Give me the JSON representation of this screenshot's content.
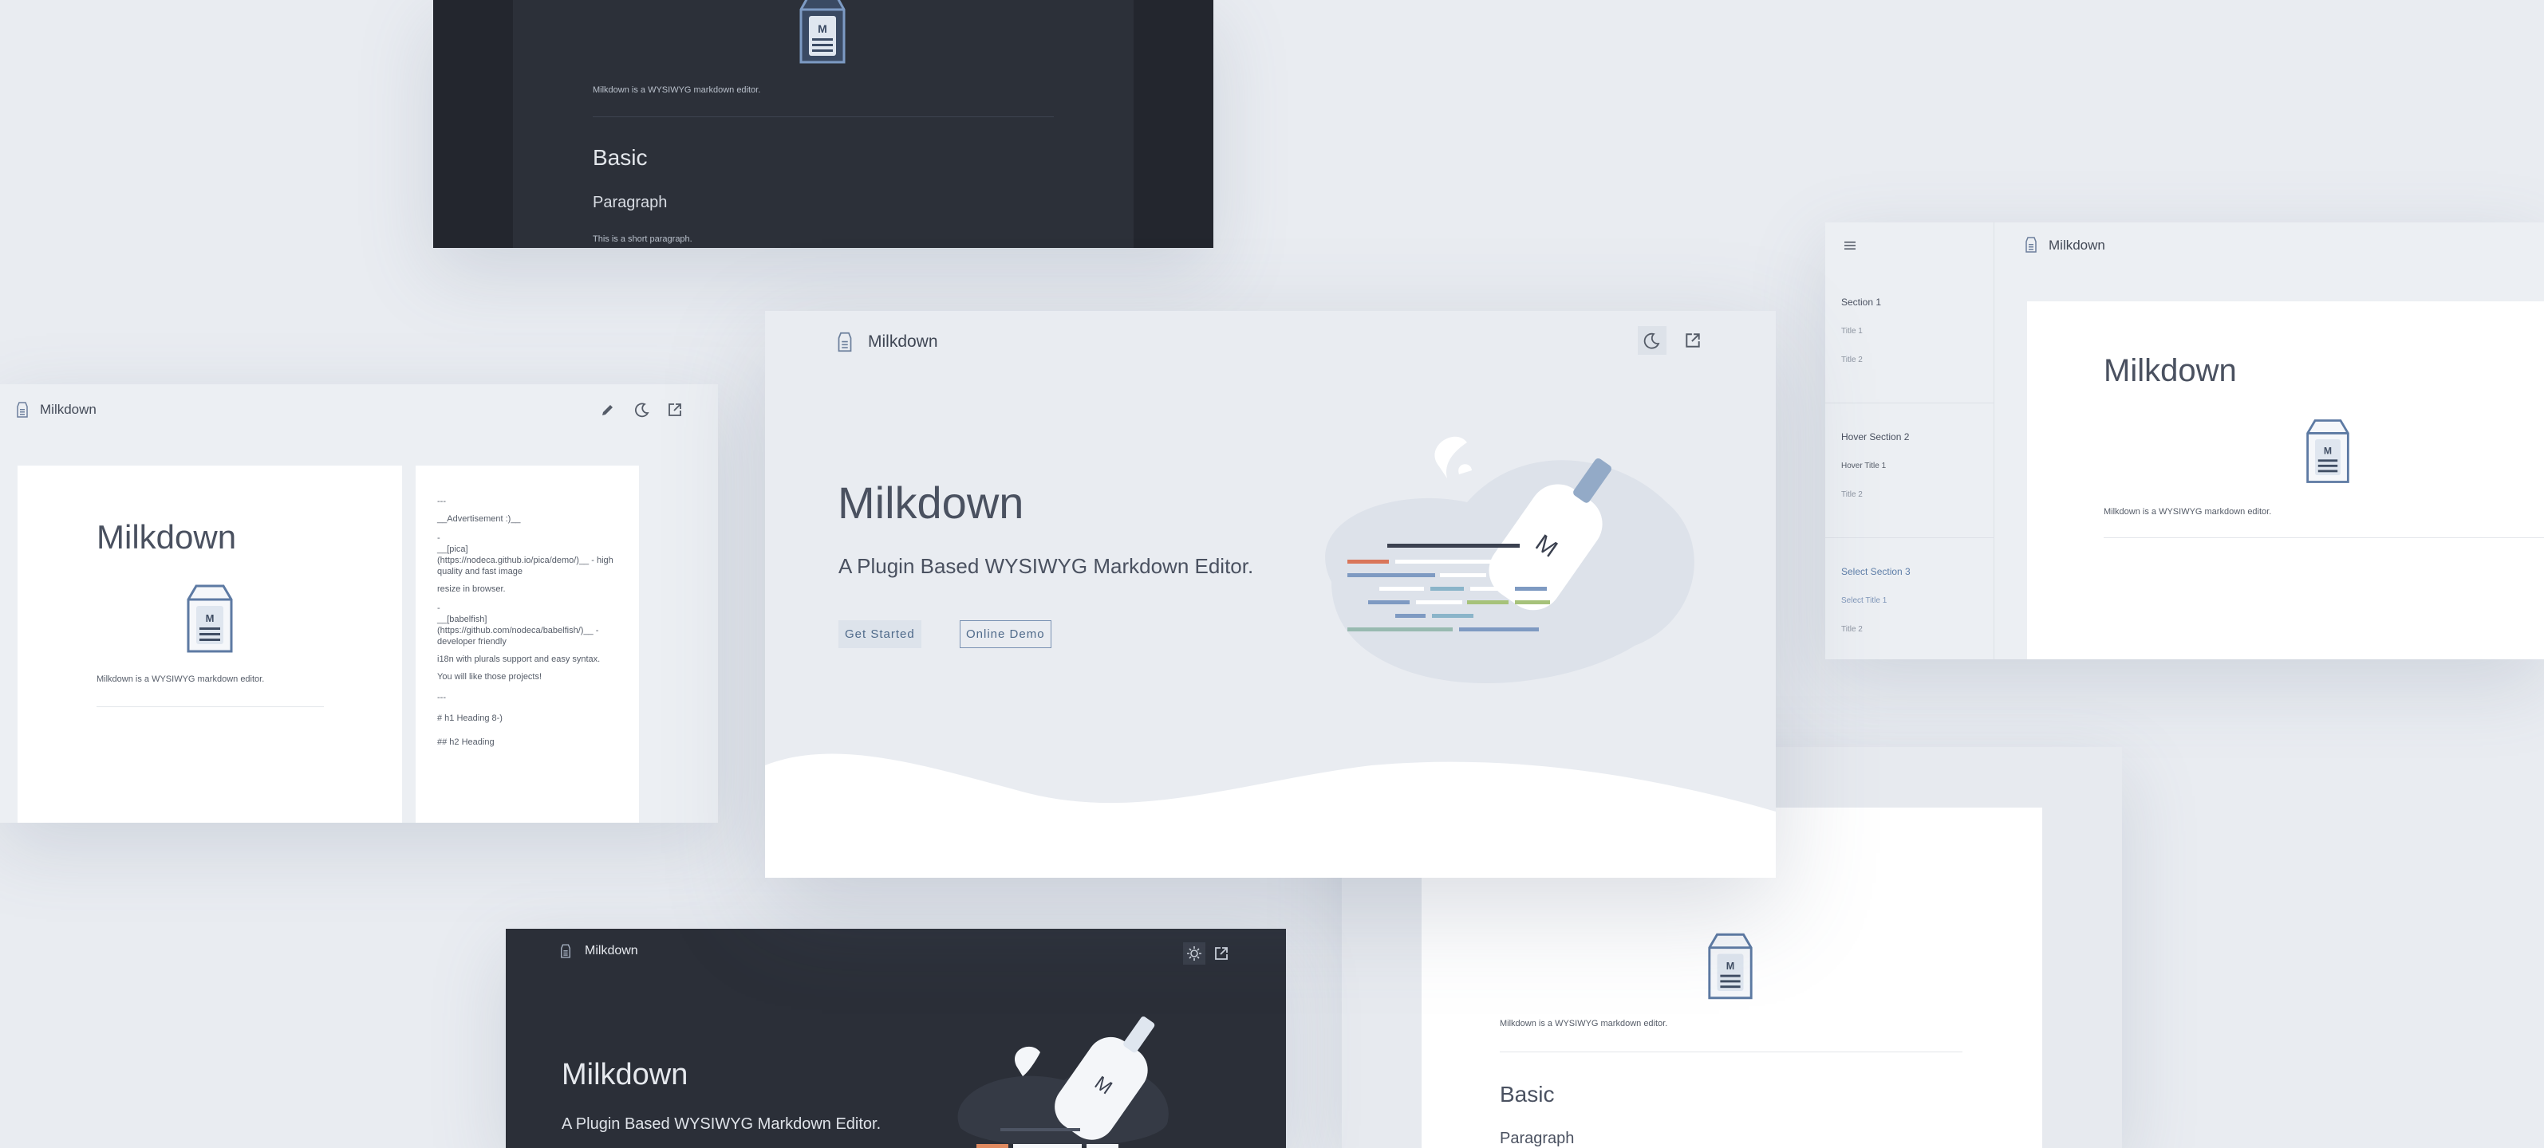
{
  "brand": "Milkdown",
  "tagline": "A Plugin Based WYSIWYG Markdown Editor.",
  "buttons": {
    "get_started": "Get Started",
    "online_demo": "Online Demo"
  },
  "logo_letter": "M",
  "doc": {
    "title": "Milkdown",
    "intro": "Milkdown is a WYSIWYG markdown editor.",
    "h2": "Basic",
    "h3": "Paragraph",
    "paragraph": "This is a short paragraph."
  },
  "source_lines": [
    "---",
    "__Advertisement :)__",
    "-",
    "__[pica](https://nodeca.github.io/pica/demo/)__ - high quality and fast image",
    "  resize in browser.",
    "-",
    "__[babelfish](https://github.com/nodeca/babelfish/)__ - developer friendly",
    "  i18n with plurals support and easy syntax.",
    "You will like those projects!",
    "---",
    "# h1 Heading 8-)",
    "## h2 Heading"
  ],
  "sidebar": {
    "sections": [
      {
        "title": "Section 1",
        "items": [
          "Title 1",
          "Title 2"
        ]
      },
      {
        "title": "Hover Section 2",
        "items": [
          "Hover Title 1",
          "Title 2"
        ]
      },
      {
        "title": "Select Section 3",
        "items": [
          "Select Title 1",
          "Title 2"
        ]
      }
    ]
  },
  "colors": {
    "accent": "#5e7ea8",
    "dark_bg": "#2b2f38",
    "light_bg": "#e9ecf1"
  },
  "icons": [
    "milk-carton-icon",
    "moon-icon",
    "sun-icon",
    "external-link-icon",
    "pencil-icon",
    "menu-icon"
  ]
}
